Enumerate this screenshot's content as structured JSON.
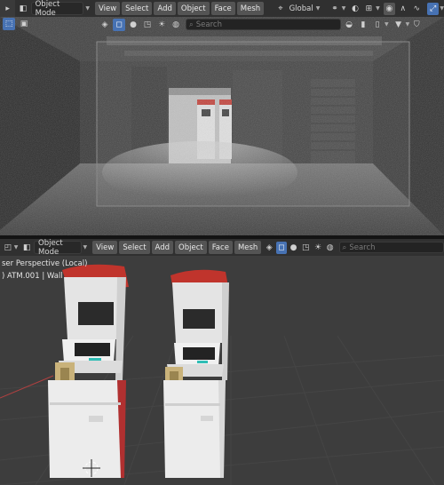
{
  "top_header": {
    "mode_label": "Object Mode",
    "menus": [
      "View",
      "Select",
      "Add",
      "Object",
      "Face",
      "Mesh"
    ],
    "transform_orientation": "Global"
  },
  "top_toolbar": {
    "search_placeholder": "Search"
  },
  "bottom_header": {
    "mode_label": "Object Mode",
    "menus": [
      "View",
      "Select",
      "Add",
      "Object",
      "Face",
      "Mesh"
    ],
    "search_placeholder": "Search"
  },
  "bottom_viewport": {
    "perspective_label": "ser Perspective (Local)",
    "object_label": ") ATM.001 | Wall"
  },
  "colors": {
    "header_bg": "#303030",
    "accent_blue": "#4772b3",
    "grid_bg": "#3d3d3d",
    "atm_red": "#c0342c"
  }
}
